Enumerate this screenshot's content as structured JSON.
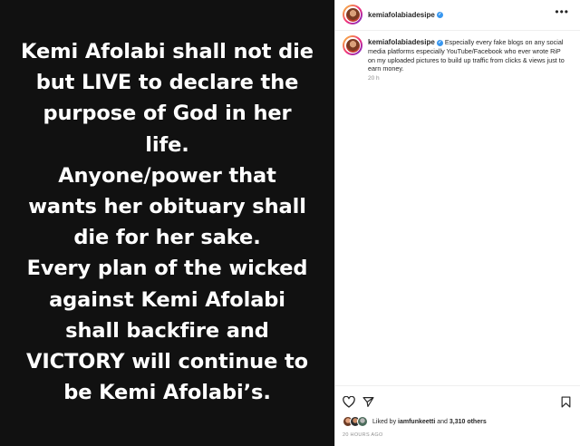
{
  "post": {
    "quote_lines": [
      "Kemi Afolabi shall not die",
      "but LIVE to declare the",
      "purpose of God in her",
      "life.",
      "Anyone/power that",
      "wants her obituary shall",
      "die for her sake.",
      "Every plan of the wicked",
      "against Kemi Afolabi",
      "shall backfire and",
      "VICTORY will continue to",
      "be Kemi Afolabi’s."
    ]
  },
  "header": {
    "username": "kemiafolabiadesipe",
    "more_label": "•••"
  },
  "caption": {
    "username": "kemiafolabiadesipe",
    "text": "Especially every fake blogs on any social media platforms especially YouTube/Facebook who ever wrote RiP on my uploaded pictures to build up traffic from clicks & views just to earn money.",
    "relative_time": "20 h"
  },
  "icons": {
    "like": "heart-icon",
    "share": "paper-plane-icon",
    "save": "bookmark-icon",
    "verified": "verified-badge-icon",
    "more": "more-options-icon"
  },
  "likes": {
    "prefix": "Liked by",
    "user": "iamfunkeetti",
    "joiner": "and",
    "count": "3,310 others"
  },
  "post_time": "20 HOURS AGO",
  "colors": {
    "image_bg": "#111111",
    "verified": "#3897f0",
    "text_primary": "#262626",
    "text_secondary": "#8e8e8e"
  }
}
